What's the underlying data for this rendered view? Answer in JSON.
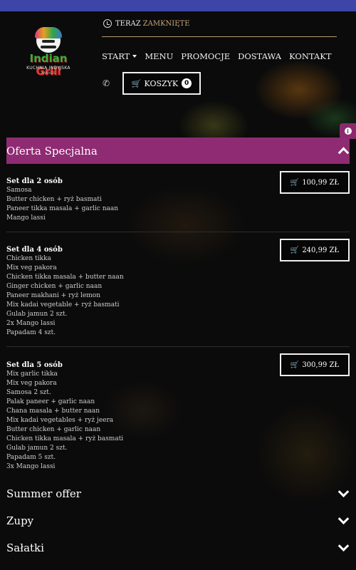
{
  "header": {
    "brand_part1": "Indian",
    "brand_part2": "Grill",
    "brand_sub": "KUCHNIA INDYJSKA",
    "brand_tagline": "NAMASTE",
    "status_label": "TERAZ",
    "status_value": "ZAMKNIĘTE",
    "nav": [
      "START",
      "MENU",
      "PROMOCJE",
      "DOSTAWA",
      "KONTAKT"
    ],
    "cart_label": "KOSZYK",
    "cart_count": "0"
  },
  "colors": {
    "top_bar": "#3d45a8",
    "accent": "#8f2b72",
    "closed_text": "#c8a57a"
  },
  "icons": [
    "clock-icon",
    "phone-icon",
    "cart-icon",
    "info-icon",
    "chevron-up-icon",
    "chevron-down-icon"
  ],
  "section_open": {
    "title": "Oferta Specjalna",
    "offers": [
      {
        "name": "Set dla 2 osób",
        "price": "100,99 ZŁ",
        "items": [
          "Samosa",
          "Butter chicken + ryż basmati",
          "Paneer tikka masala + garlic naan",
          "Mango lassi"
        ]
      },
      {
        "name": "Set dla 4 osób",
        "price": "240,99 ZŁ",
        "items": [
          "Chicken tikka",
          "Mix veg pakora",
          "Chicken tikka masala + butter naan",
          "Ginger chicken + garlic naan",
          "Paneer makhani + ryż lemon",
          "Mix kadai vegetable + ryż basmati",
          "Gulab jamun 2 szt.",
          "2x Mango lassi",
          "Papadam 4 szt."
        ]
      },
      {
        "name": "Set dla 5 osób",
        "price": "300,99 ZŁ",
        "items": [
          "Mix garlic tikka",
          "Mix veg pakora",
          "Samosa 2 szt.",
          "Palak paneer + garlic naan",
          "Chana masala + butter naan",
          "Mix kadai vegetables + ryż jeera",
          "Butter chicken + garlic naan",
          "Chicken tikka masala + ryż basmati",
          "Gulab jamun 2 szt.",
          "Papadam 5 szt.",
          "3x Mango lassi"
        ]
      }
    ]
  },
  "sections_collapsed": [
    "Summer offer",
    "Zupy",
    "Sałatki"
  ]
}
